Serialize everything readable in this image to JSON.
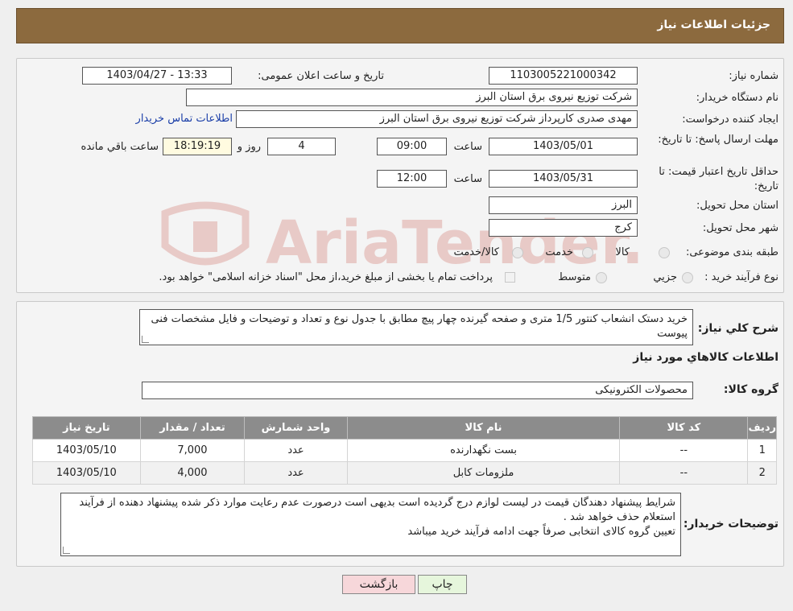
{
  "header": {
    "title": "جزئیات اطلاعات نیاز"
  },
  "form": {
    "need_number_label": "شماره نیاز:",
    "need_number": "1103005221000342",
    "announce_label": "تاریخ و ساعت اعلان عمومی:",
    "announce_value": "1403/04/27 - 13:33",
    "buyer_org_label": "نام دستگاه خریدار:",
    "buyer_org": "شرکت توزیع نیروی برق استان البرز",
    "requester_label": "ایجاد کننده درخواست:",
    "requester": "مهدی صدری کارپرداز شرکت توزیع نیروی برق استان البرز",
    "contact_link": "اطلاعات تماس خریدار",
    "deadline_label": "مهلت ارسال پاسخ: تا تاریخ:",
    "deadline_date": "1403/05/01",
    "time_label": "ساعت",
    "deadline_time": "09:00",
    "days_value": "4",
    "days_label": "روز و",
    "remaining_time": "18:19:19",
    "remaining_label": "ساعت باقي مانده",
    "validity_label": "حداقل تاریخ اعتبار قیمت: تا تاریخ:",
    "validity_date": "1403/05/31",
    "validity_time": "12:00",
    "province_label": "استان محل تحویل:",
    "province": "البرز",
    "city_label": "شهر محل تحویل:",
    "city": "کرج",
    "category_label": "طبقه بندی موضوعی:",
    "category_options": [
      "کالا",
      "خدمت",
      "کالا/خدمت"
    ],
    "process_label": "نوع فرآیند خرید :",
    "process_options": [
      "جزيي",
      "متوسط"
    ],
    "payment_note": "پرداخت تمام یا بخشی از مبلغ خرید،از محل \"اسناد خزانه اسلامی\" خواهد بود."
  },
  "description": {
    "label": "شرح كلي نياز:",
    "text": "خرید دستک انشعاب کنتور 1/5 متری  و صفحه گیرنده چهار پیچ مطابق با جدول نوع و تعداد و توضیحات و فایل مشخصات فنی پیوست"
  },
  "goods": {
    "section_title": "اطلاعات كالاهاي مورد نياز",
    "group_label": "گروه كالا:",
    "group_value": "محصولات الکترونیکی",
    "columns": [
      "رديف",
      "كد كالا",
      "نام كالا",
      "واحد شمارش",
      "تعداد / مقدار",
      "تاريخ نياز"
    ],
    "rows": [
      {
        "row": "1",
        "code": "--",
        "name": "بست نگهدارنده",
        "unit": "عدد",
        "qty": "7,000",
        "date": "1403/05/10"
      },
      {
        "row": "2",
        "code": "--",
        "name": "ملزومات کابل",
        "unit": "عدد",
        "qty": "4,000",
        "date": "1403/05/10"
      }
    ]
  },
  "buyer_notes": {
    "label": "توضيحات خريدار:",
    "line1": "شرایط پیشنهاد دهندگان قیمت در لیست لوازم درج گردیده است بدیهی است درصورت عدم رعایت موارد  ذکر شده پیشنهاد دهنده از فرآیند استعلام حذف خواهد شد .",
    "line2": "تعیین گروه کالای انتخابی صرفاً جهت ادامه فرآیند خرید میباشد"
  },
  "buttons": {
    "print": "چاپ",
    "back": "بازگشت"
  },
  "watermark": {
    "text": "AriaTender.neT"
  },
  "colors": {
    "header": "#8c6a3e",
    "table_header": "#8c8c8c",
    "link": "#1a3ea8",
    "back_button": "#f7d7da",
    "print_button": "#e6f6dc"
  }
}
